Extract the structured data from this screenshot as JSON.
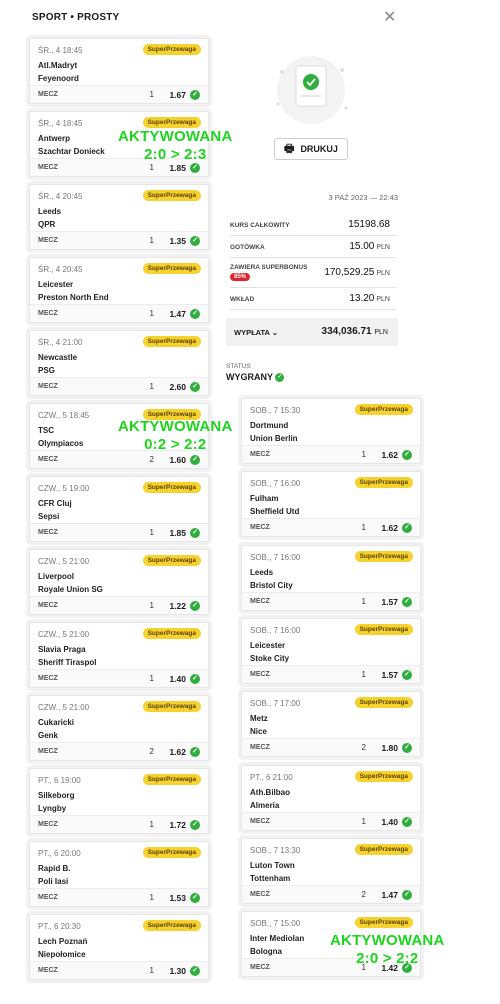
{
  "header": {
    "title": "SPORT  •  PROSTY",
    "close": "✕"
  },
  "print_button": {
    "label": "DRUKUJ"
  },
  "summary": {
    "date": "3 PAŹ 2023 — 22:43",
    "total_odds_label": "KURS CAŁKOWITY",
    "total_odds": "15198.68",
    "cash_label": "GOTÓWKA",
    "cash": "15.00",
    "cash_unit": "PLN",
    "superbonus_label": "ZAWIERA SUPERBONUS",
    "superbonus_pct": "85%",
    "superbonus": "170,529.25",
    "superbonus_unit": "PLN",
    "stake_label": "WKŁAD",
    "stake": "13.20",
    "stake_unit": "PLN",
    "payout_label": "WYPŁATA",
    "payout": "334,036.71",
    "payout_unit": "PLN",
    "status_label": "STATUS",
    "status": "WYGRANY"
  },
  "badge_label": "SuperPrzewaga",
  "bet_type": "MECZ",
  "left_bets": [
    {
      "date": "ŚR., 4  18:45",
      "home": "Atl.Madryt",
      "away": "Feyenoord",
      "pick": "1",
      "odds": "1.67"
    },
    {
      "date": "ŚR., 4  18:45",
      "home": "Antwerp",
      "away": "Szachtar Donieck",
      "pick": "1",
      "odds": "1.85"
    },
    {
      "date": "ŚR., 4  20:45",
      "home": "Leeds",
      "away": "QPR",
      "pick": "1",
      "odds": "1.35"
    },
    {
      "date": "ŚR., 4  20:45",
      "home": "Leicester",
      "away": "Preston North End",
      "pick": "1",
      "odds": "1.47"
    },
    {
      "date": "ŚR., 4  21:00",
      "home": "Newcastle",
      "away": "PSG",
      "pick": "1",
      "odds": "2.60"
    },
    {
      "date": "CZW., 5  18:45",
      "home": "TSC",
      "away": "Olympiacos",
      "pick": "2",
      "odds": "1.60"
    },
    {
      "date": "CZW., 5  19:00",
      "home": "CFR Cluj",
      "away": "Sepsi",
      "pick": "1",
      "odds": "1.85"
    },
    {
      "date": "CZW., 5  21:00",
      "home": "Liverpool",
      "away": "Royale Union SG",
      "pick": "1",
      "odds": "1.22"
    },
    {
      "date": "CZW., 5  21:00",
      "home": "Slavia Praga",
      "away": "Sheriff Tiraspol",
      "pick": "1",
      "odds": "1.40"
    },
    {
      "date": "CZW., 5  21:00",
      "home": "Cukaricki",
      "away": "Genk",
      "pick": "2",
      "odds": "1.62"
    },
    {
      "date": "PT., 6  19:00",
      "home": "Silkeborg",
      "away": "Lyngby",
      "pick": "1",
      "odds": "1.72"
    },
    {
      "date": "PT., 6  20:00",
      "home": "Rapid B.",
      "away": "Poli Iasi",
      "pick": "1",
      "odds": "1.53"
    },
    {
      "date": "PT., 6  20:30",
      "home": "Lech Poznań",
      "away": "Niepołomice",
      "pick": "1",
      "odds": "1.30"
    }
  ],
  "right_bets": [
    {
      "date": "SOB., 7  15:30",
      "home": "Dortmund",
      "away": "Union Berlin",
      "pick": "1",
      "odds": "1.62"
    },
    {
      "date": "SOB., 7  16:00",
      "home": "Fulham",
      "away": "Sheffield Utd",
      "pick": "1",
      "odds": "1.62"
    },
    {
      "date": "SOB., 7  16:00",
      "home": "Leeds",
      "away": "Bristol City",
      "pick": "1",
      "odds": "1.57"
    },
    {
      "date": "SOB., 7  16:00",
      "home": "Leicester",
      "away": "Stoke City",
      "pick": "1",
      "odds": "1.57"
    },
    {
      "date": "SOB., 7  17:00",
      "home": "Metz",
      "away": "Nice",
      "pick": "2",
      "odds": "1.80"
    },
    {
      "date": "PT., 6  21:00",
      "home": "Ath.Bilbao",
      "away": "Almeria",
      "pick": "1",
      "odds": "1.40"
    },
    {
      "date": "SOB., 7  13:30",
      "home": "Luton Town",
      "away": "Tottenham",
      "pick": "2",
      "odds": "1.47"
    },
    {
      "date": "SOB., 7  15:00",
      "home": "Inter Mediolan",
      "away": "Bologna",
      "pick": "1",
      "odds": "1.42"
    }
  ],
  "annotations": [
    {
      "line1": "AKTYWOWANA",
      "line2": "2:0 > 2:3"
    },
    {
      "line1": "AKTYWOWANA",
      "line2": "0:2 > 2:2"
    },
    {
      "line1": "AKTYWOWANA",
      "line2": "2:0 > 2:2"
    }
  ],
  "colors": {
    "badge": "#f6d22f",
    "check": "#2fae3e",
    "annotation": "#1ed51e",
    "superbonus": "#e0262c"
  }
}
